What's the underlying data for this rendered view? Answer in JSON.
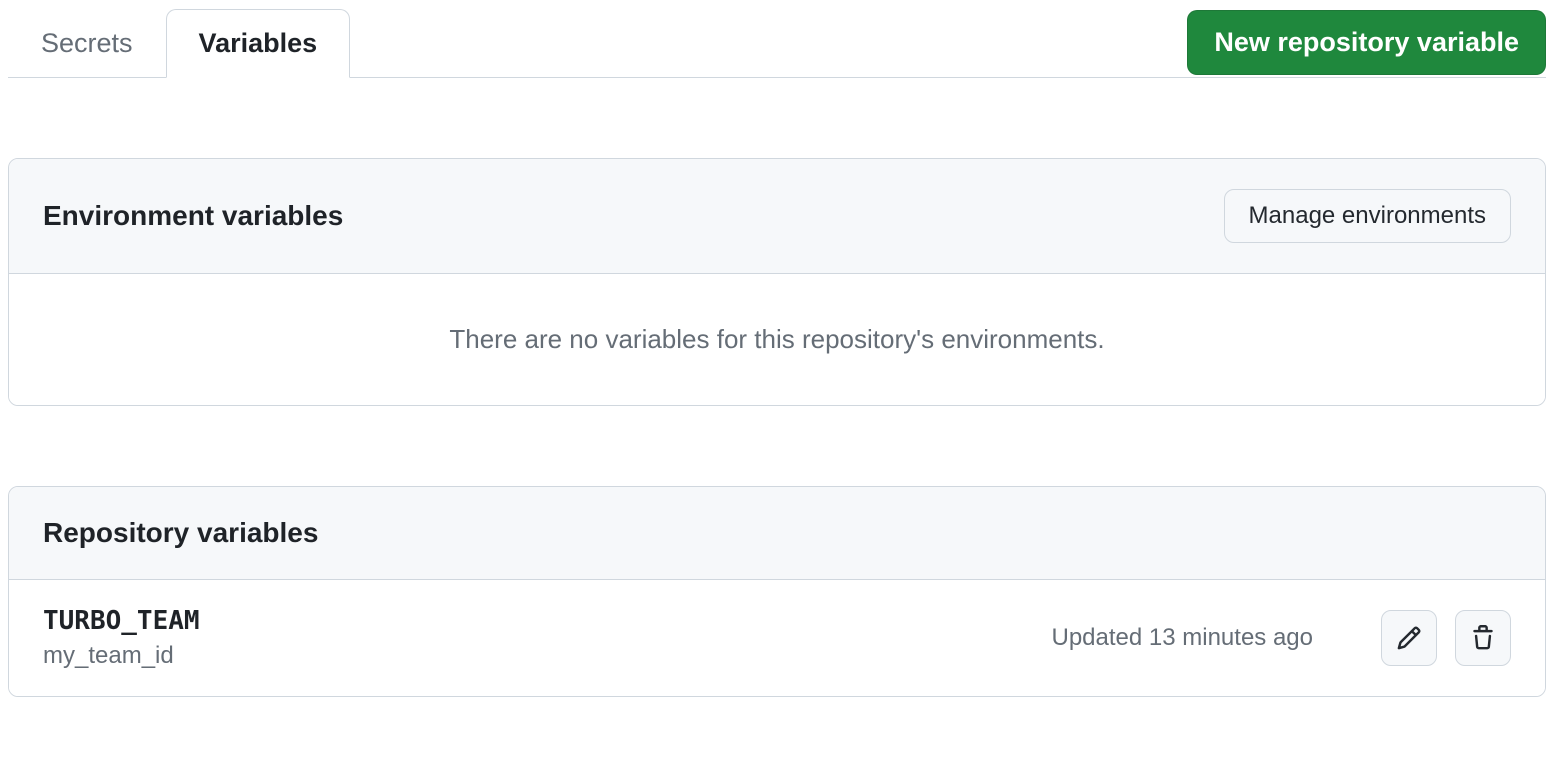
{
  "tabs": {
    "secrets": "Secrets",
    "variables": "Variables"
  },
  "new_button": "New repository variable",
  "environment": {
    "title": "Environment variables",
    "manage_button": "Manage environments",
    "empty_message": "There are no variables for this repository's environments."
  },
  "repository": {
    "title": "Repository variables",
    "variables": [
      {
        "name": "TURBO_TEAM",
        "value": "my_team_id",
        "updated": "Updated 13 minutes ago"
      }
    ]
  }
}
